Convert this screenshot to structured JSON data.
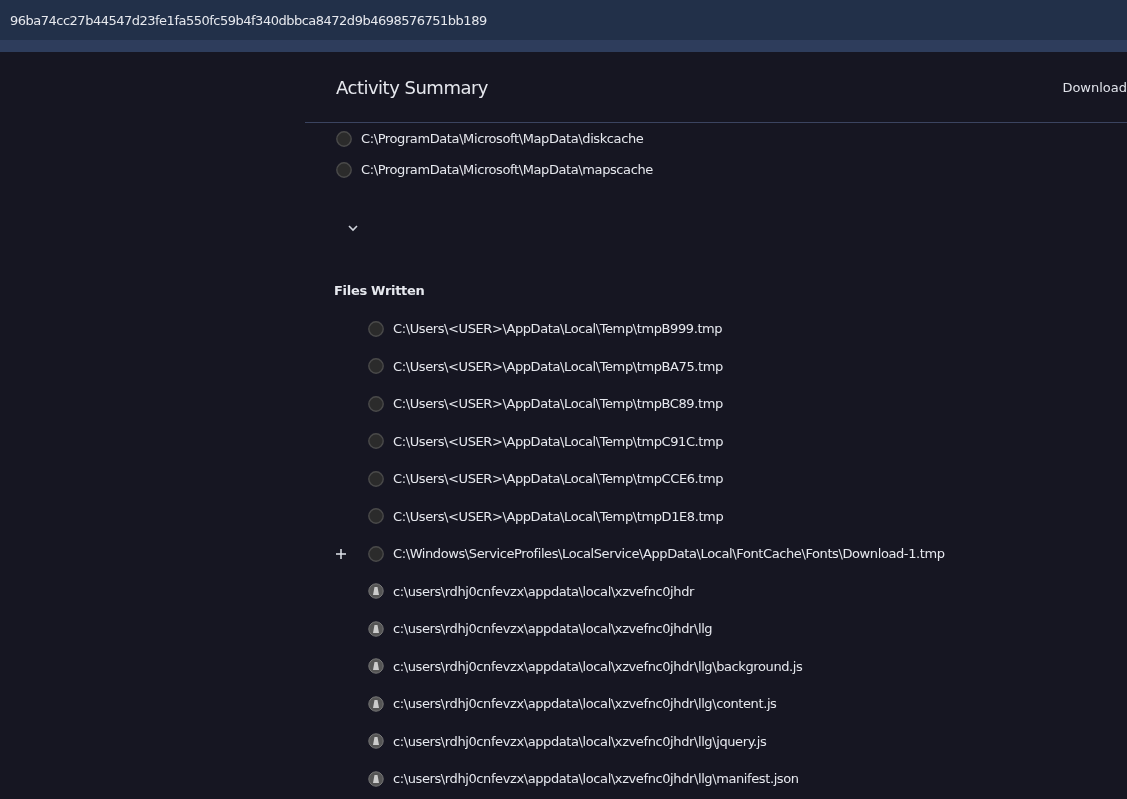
{
  "title_bar": {
    "title": "96ba74cc27b44547d23fe1fa550fc59b4f340dbbca8472d9b4698576751bb189"
  },
  "header": {
    "title": "Activity Summary",
    "action": "Download"
  },
  "previous_list": {
    "items": [
      {
        "path": "C:\\ProgramData\\Microsoft\\MapData\\diskcache",
        "kind": "generic"
      },
      {
        "path": "C:\\ProgramData\\Microsoft\\MapData\\mapscache",
        "kind": "generic"
      }
    ],
    "collapse_toggle": {
      "expanded": true
    }
  },
  "files_written": {
    "heading": "Files Written",
    "items": [
      {
        "path": "C:\\Users\\<USER>\\AppData\\Local\\Temp\\tmpB999.tmp",
        "kind": "generic",
        "expandable": false
      },
      {
        "path": "C:\\Users\\<USER>\\AppData\\Local\\Temp\\tmpBA75.tmp",
        "kind": "generic",
        "expandable": false
      },
      {
        "path": "C:\\Users\\<USER>\\AppData\\Local\\Temp\\tmpBC89.tmp",
        "kind": "generic",
        "expandable": false
      },
      {
        "path": "C:\\Users\\<USER>\\AppData\\Local\\Temp\\tmpC91C.tmp",
        "kind": "generic",
        "expandable": false
      },
      {
        "path": "C:\\Users\\<USER>\\AppData\\Local\\Temp\\tmpCCE6.tmp",
        "kind": "generic",
        "expandable": false
      },
      {
        "path": "C:\\Users\\<USER>\\AppData\\Local\\Temp\\tmpD1E8.tmp",
        "kind": "generic",
        "expandable": false
      },
      {
        "path": "C:\\Windows\\ServiceProfiles\\LocalService\\AppData\\Local\\FontCache\\Fonts\\Download-1.tmp",
        "kind": "generic",
        "expandable": true
      },
      {
        "path": "c:\\users\\rdhj0cnfevzx\\appdata\\local\\xzvefnc0jhdr",
        "kind": "flagged",
        "expandable": false
      },
      {
        "path": "c:\\users\\rdhj0cnfevzx\\appdata\\local\\xzvefnc0jhdr\\llg",
        "kind": "flagged",
        "expandable": false
      },
      {
        "path": "c:\\users\\rdhj0cnfevzx\\appdata\\local\\xzvefnc0jhdr\\llg\\background.js",
        "kind": "flagged",
        "expandable": false
      },
      {
        "path": "c:\\users\\rdhj0cnfevzx\\appdata\\local\\xzvefnc0jhdr\\llg\\content.js",
        "kind": "flagged",
        "expandable": false
      },
      {
        "path": "c:\\users\\rdhj0cnfevzx\\appdata\\local\\xzvefnc0jhdr\\llg\\jquery.js",
        "kind": "flagged",
        "expandable": false
      },
      {
        "path": "c:\\users\\rdhj0cnfevzx\\appdata\\local\\xzvefnc0jhdr\\llg\\manifest.json",
        "kind": "flagged",
        "expandable": false
      }
    ]
  }
}
